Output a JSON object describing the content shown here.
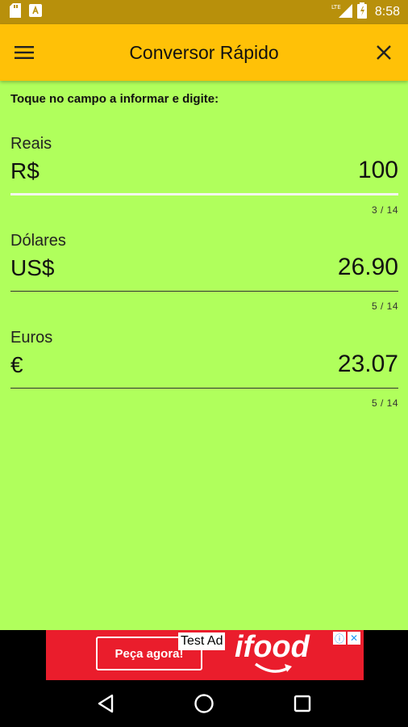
{
  "status_bar": {
    "network": "LTE",
    "time": "8:58"
  },
  "app_bar": {
    "title": "Conversor Rápido",
    "menu_icon": "hamburger-icon",
    "close_icon": "close-icon"
  },
  "instruction": "Toque no campo a informar e digite:",
  "fields": [
    {
      "label": "Reais",
      "prefix": "R$",
      "value": "100",
      "counter": "3 / 14",
      "focused": true
    },
    {
      "label": "Dólares",
      "prefix": "US$",
      "value": "26.90",
      "counter": "5 / 14",
      "focused": false
    },
    {
      "label": "Euros",
      "prefix": "€",
      "value": "23.07",
      "counter": "5 / 14",
      "focused": false
    }
  ],
  "ad": {
    "label": "Test Ad",
    "button_text": "Peça agora!",
    "brand": "ifood",
    "color": "#ea1d2c"
  },
  "colors": {
    "status_bar": "#b8900b",
    "app_bar": "#ffc107",
    "background": "#b0ff5c"
  }
}
